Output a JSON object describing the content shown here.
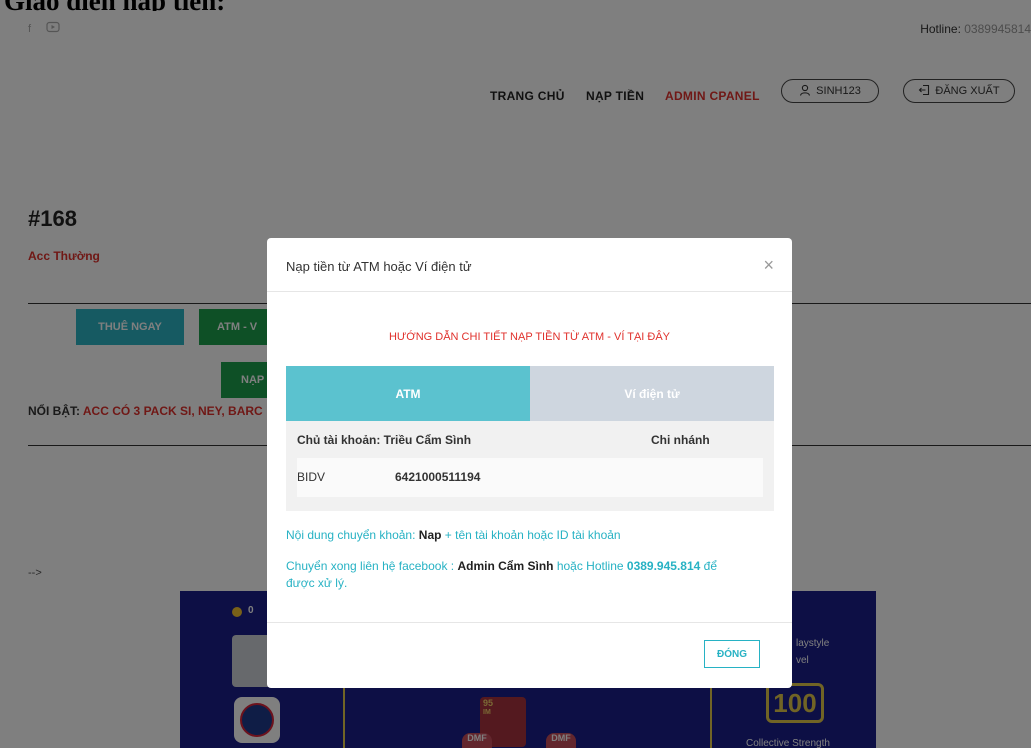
{
  "doc_title": "Giao diện nạp tiền:",
  "topbar": {
    "facebook_icon": "facebook-icon",
    "youtube_icon": "youtube-icon",
    "hotline_label": "Hotline:",
    "hotline_number": "0389945814"
  },
  "nav": {
    "home": "TRANG CHỦ",
    "deposit": "NẠP TIỀN",
    "admin": "ADMIN CPANEL",
    "user": "SINH123",
    "logout": "ĐĂNG XUẤT"
  },
  "account": {
    "code": "#168",
    "type": "Acc Thường",
    "rent_button": "THUÊ NGAY",
    "atm_button": "ATM - V",
    "deposit_button": "NẠP",
    "featured_label": "NỔI BẬT:",
    "featured_text": "ACC CÓ 3 PACK SI, NEY, BARC",
    "arrow": "-->"
  },
  "game": {
    "coins": "0",
    "playstyle": "laystyle",
    "level_label": "vel",
    "strength_value": "100",
    "collective_strength": "Collective Strength",
    "card_rating": "95",
    "card_tag": "IM",
    "dmf1": "DMF",
    "dmf2": "DMF"
  },
  "modal": {
    "title": "Nạp tiền từ ATM hoặc Ví điện tử",
    "close_symbol": "×",
    "guide": "HƯỚNG DẪN CHI TIẾT NẠP TIỀN TỪ ATM - VÍ TẠI ĐÂY",
    "tabs": [
      {
        "label": "ATM",
        "color": "#5bc2cf"
      },
      {
        "label": "Ví điện tử",
        "color": "#ced6df"
      }
    ],
    "bank": {
      "owner_label": "Chủ tài khoản: Triều Cẩm Sình",
      "branch_label": "Chi nhánh",
      "bank_name": "BIDV",
      "account_number": "6421000511194"
    },
    "transfer": {
      "prefix": "Nội dung chuyển khoản:",
      "keyword": "Nap",
      "suffix": "+ tên tài khoản hoặc ID tài khoản"
    },
    "contact": {
      "prefix": "Chuyển xong liên hệ facebook :",
      "admin": "Admin Cẩm Sình",
      "mid": "hoặc Hotline",
      "phone": "0389.945.814",
      "suffix": "để",
      "line2": "được xử lý."
    },
    "close_button": "ĐÓNG"
  },
  "colors": {
    "accent_red": "#e0312c",
    "teal": "#27b2c4",
    "green": "#1ca04c",
    "tab_active": "#5bc2cf",
    "tab_inactive": "#ced6df"
  }
}
